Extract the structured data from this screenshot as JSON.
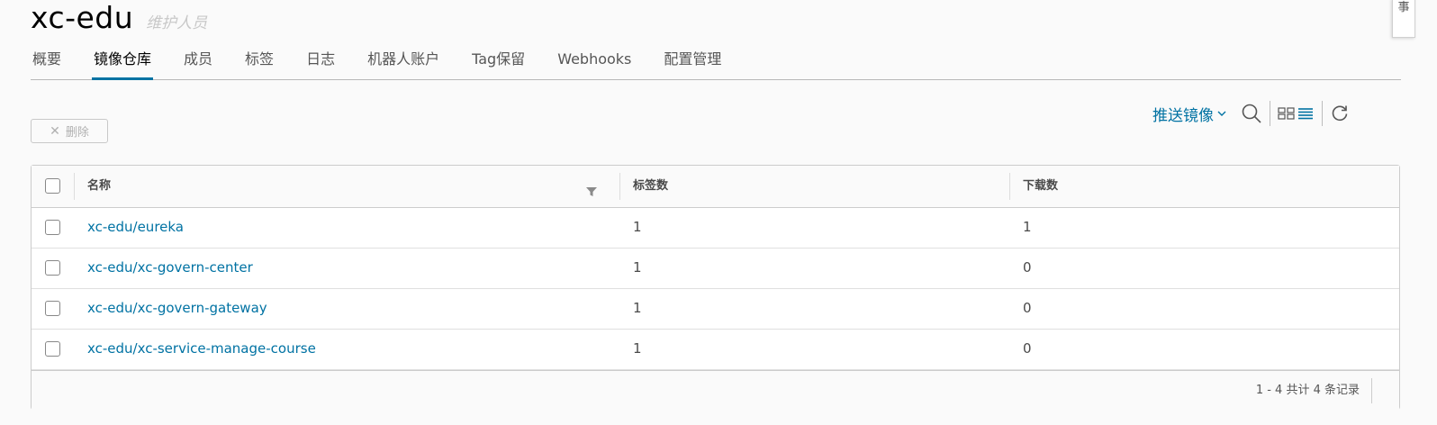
{
  "project": {
    "title": "xc-edu",
    "role": "维护人员"
  },
  "tabs": [
    {
      "label": "概要",
      "active": false
    },
    {
      "label": "镜像仓库",
      "active": true
    },
    {
      "label": "成员",
      "active": false
    },
    {
      "label": "标签",
      "active": false
    },
    {
      "label": "日志",
      "active": false
    },
    {
      "label": "机器人账户",
      "active": false
    },
    {
      "label": "Tag保留",
      "active": false
    },
    {
      "label": "Webhooks",
      "active": false
    },
    {
      "label": "配置管理",
      "active": false
    }
  ],
  "actions": {
    "delete_label": "删除",
    "push_label": "推送镜像"
  },
  "table": {
    "columns": [
      "名称",
      "标签数",
      "下载数"
    ],
    "rows": [
      {
        "name": "xc-edu/eureka",
        "tags": "1",
        "pulls": "1"
      },
      {
        "name": "xc-edu/xc-govern-center",
        "tags": "1",
        "pulls": "0"
      },
      {
        "name": "xc-edu/xc-govern-gateway",
        "tags": "1",
        "pulls": "0"
      },
      {
        "name": "xc-edu/xc-service-manage-course",
        "tags": "1",
        "pulls": "0"
      }
    ],
    "footer": "1 - 4 共计 4 条记录"
  },
  "side_tab": {
    "label": "事"
  },
  "colors": {
    "accent": "#0072a3",
    "text": "#313131",
    "border": "#cccccc"
  },
  "icons": [
    "close-icon",
    "chevron-down-icon",
    "search-icon",
    "card-view-icon",
    "list-view-icon",
    "refresh-icon",
    "filter-icon"
  ]
}
